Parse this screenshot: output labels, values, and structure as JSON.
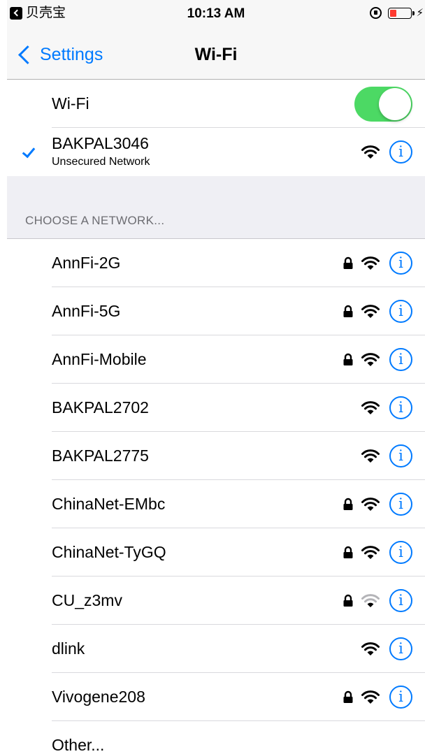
{
  "status_bar": {
    "app_name": "贝壳宝",
    "time": "10:13 AM",
    "battery_color": "#ff3b30"
  },
  "nav": {
    "back_label": "Settings",
    "title": "Wi-Fi"
  },
  "wifi_toggle": {
    "label": "Wi-Fi",
    "on": true,
    "on_color": "#4cd964"
  },
  "connected": {
    "name": "BAKPAL3046",
    "subtitle": "Unsecured Network"
  },
  "section_header": "CHOOSE A NETWORK...",
  "networks": [
    {
      "name": "AnnFi-2G",
      "locked": true,
      "signal": "full"
    },
    {
      "name": "AnnFi-5G",
      "locked": true,
      "signal": "full"
    },
    {
      "name": "AnnFi-Mobile",
      "locked": true,
      "signal": "full"
    },
    {
      "name": "BAKPAL2702",
      "locked": false,
      "signal": "full"
    },
    {
      "name": "BAKPAL2775",
      "locked": false,
      "signal": "full"
    },
    {
      "name": "ChinaNet-EMbc",
      "locked": true,
      "signal": "full"
    },
    {
      "name": "ChinaNet-TyGQ",
      "locked": true,
      "signal": "full"
    },
    {
      "name": "CU_z3mv",
      "locked": true,
      "signal": "weak"
    },
    {
      "name": "dlink",
      "locked": false,
      "signal": "full"
    },
    {
      "name": "Vivogene208",
      "locked": true,
      "signal": "full"
    }
  ],
  "other_label": "Other...",
  "info_glyph": "i",
  "accent_color": "#007aff"
}
